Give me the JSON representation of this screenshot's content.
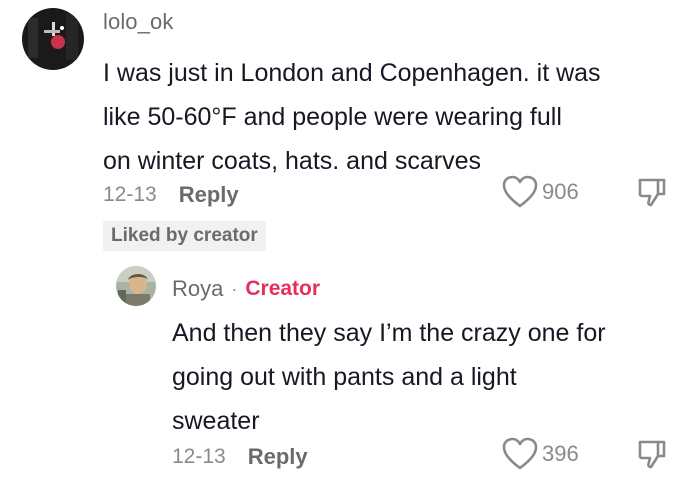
{
  "comment": {
    "avatar_icon": "user-avatar-dark-photo",
    "username": "lolo_ok",
    "lines": [
      "I was just in London and Copenhagen. it was",
      "like 50-60°F and people were wearing full",
      "on winter coats, hats. and scarves"
    ],
    "date": "12-13",
    "reply_label": "Reply",
    "like_icon": "heart-outline-icon",
    "likes": "906",
    "dislike_icon": "thumbs-down-icon",
    "liked_badge": "Liked by creator"
  },
  "reply": {
    "avatar_icon": "user-avatar-photo",
    "username": "Roya",
    "separator": "·",
    "role": "Creator",
    "lines": [
      "And then they say I’m the crazy one for",
      "going out with pants and a light",
      "sweater"
    ],
    "date": "12-13",
    "reply_label": "Reply",
    "like_icon": "heart-outline-icon",
    "likes": "396",
    "dislike_icon": "thumbs-down-icon"
  },
  "colors": {
    "accent_creator": "#e3305e",
    "text_primary": "#161823",
    "text_secondary": "#8a8a8a"
  }
}
